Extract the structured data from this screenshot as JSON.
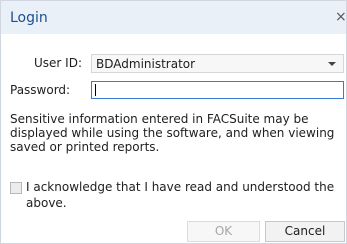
{
  "dialog": {
    "title": "Login",
    "close_glyph": "×",
    "user_id": {
      "label": "User ID:",
      "selected_value": "BDAdministrator"
    },
    "password": {
      "label": "Password:",
      "value": ""
    },
    "info_text": "Sensitive information entered in FACSuite may be displayed while using the software, and when viewing saved or printed reports.",
    "acknowledge": {
      "text": "I acknowledge that I have read and understood the above.",
      "checked": false
    },
    "buttons": {
      "ok_label": "OK",
      "ok_enabled": false,
      "cancel_label": "Cancel"
    }
  },
  "colors": {
    "title_text": "#1c4f8c",
    "titlebar_bg": "#e9f0f8",
    "focus_border": "#3a7bd5"
  },
  "icons": [
    "close-icon",
    "dropdown-arrow-icon"
  ]
}
